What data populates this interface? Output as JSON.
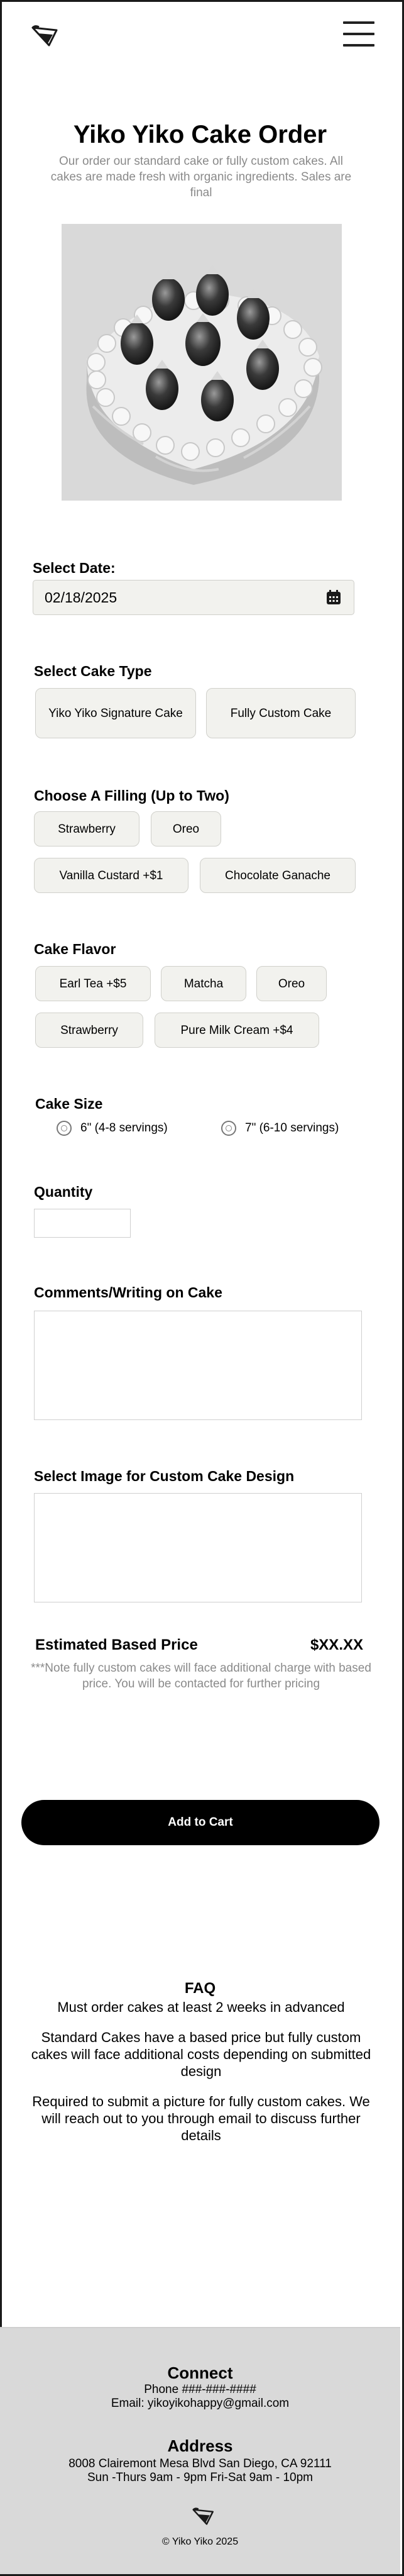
{
  "header": {
    "logo_icon": "cake-slice-logo-icon",
    "menu_icon": "hamburger-menu-icon"
  },
  "page": {
    "title": "Yiko Yiko Cake Order",
    "subtitle": "Our order our standard cake or fully custom cakes. All cakes are made fresh with organic ingredients. Sales are final"
  },
  "date": {
    "label": "Select Date:",
    "value": "02/18/2025",
    "icon": "calendar-icon"
  },
  "cake_type": {
    "label": "Select Cake Type",
    "options": [
      "Yiko Yiko Signature Cake",
      "Fully Custom Cake"
    ]
  },
  "filling": {
    "label": "Choose A Filling (Up to Two)",
    "options": [
      "Strawberry",
      "Oreo",
      "Vanilla Custard +$1",
      "Chocolate Ganache"
    ]
  },
  "flavor": {
    "label": "Cake Flavor",
    "options": [
      "Earl Tea +$5",
      "Matcha",
      "Oreo",
      "Strawberry",
      "Pure Milk Cream +$4"
    ]
  },
  "size": {
    "label": "Cake Size",
    "options": [
      "6\" (4-8 servings)",
      "7\" (6-10 servings)"
    ]
  },
  "quantity": {
    "label": "Quantity"
  },
  "comments": {
    "label": "Comments/Writing on Cake"
  },
  "image_upload": {
    "label": "Select Image for Custom Cake Design"
  },
  "price": {
    "label": "Estimated Based Price",
    "value": "$XX.XX",
    "note": "***Note fully custom cakes will face additional charge with based price. You will be contacted for further pricing"
  },
  "cart": {
    "button_label": "Add to Cart"
  },
  "faq": {
    "title": "FAQ",
    "items": [
      "Must order cakes at least 2 weeks in advanced",
      "Standard Cakes have a based price but fully custom cakes will face additional costs depending on submitted design",
      "Required to submit a picture for fully custom cakes. We will reach out to you through email to discuss further details"
    ]
  },
  "footer": {
    "connect_title": "Connect",
    "phone": "Phone ###-###-####",
    "email": "Email: yikoyikohappy@gmail.com",
    "address_title": "Address",
    "address": "8008 Clairemont Mesa Blvd San Diego, CA 92111",
    "hours": "Sun -Thurs 9am - 9pm  Fri-Sat 9am - 10pm",
    "copyright": "© Yiko Yiko 2025"
  }
}
